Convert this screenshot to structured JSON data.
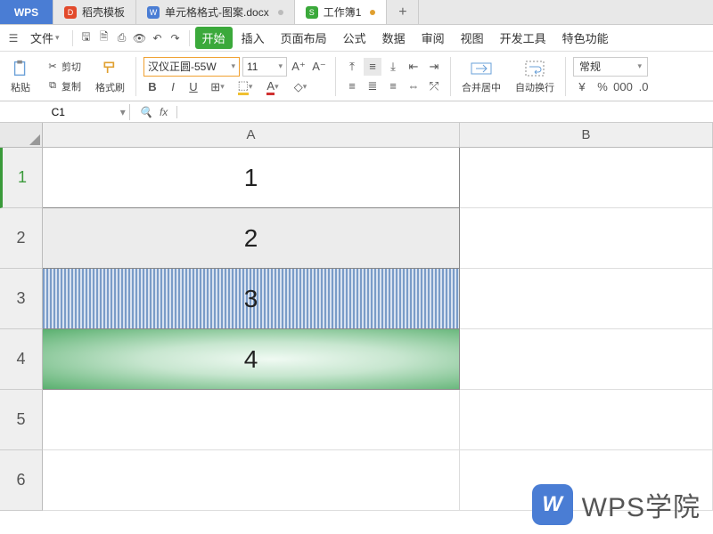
{
  "tabs": {
    "wps": "WPS",
    "docer": "稻壳模板",
    "doc": "单元格格式-图案.docx",
    "sheet": "工作簿1"
  },
  "menu": {
    "file": "文件",
    "start": "开始",
    "insert": "插入",
    "pagelayout": "页面布局",
    "formula": "公式",
    "data": "数据",
    "review": "审阅",
    "view": "视图",
    "dev": "开发工具",
    "special": "特色功能"
  },
  "toolbar": {
    "paste": "粘贴",
    "cut": "剪切",
    "copy": "复制",
    "formatpainter": "格式刷",
    "font_name": "汉仪正圆-55W",
    "font_size": "11",
    "merge": "合并居中",
    "wrap": "自动换行",
    "numfmt": "常规"
  },
  "namebox": "C1",
  "fx": "fx",
  "columns": {
    "A": "A",
    "B": "B"
  },
  "rows": [
    "1",
    "2",
    "3",
    "4",
    "5",
    "6"
  ],
  "cells": {
    "A1": "1",
    "A2": "2",
    "A3": "3",
    "A4": "4"
  },
  "watermark": "WPS学院"
}
